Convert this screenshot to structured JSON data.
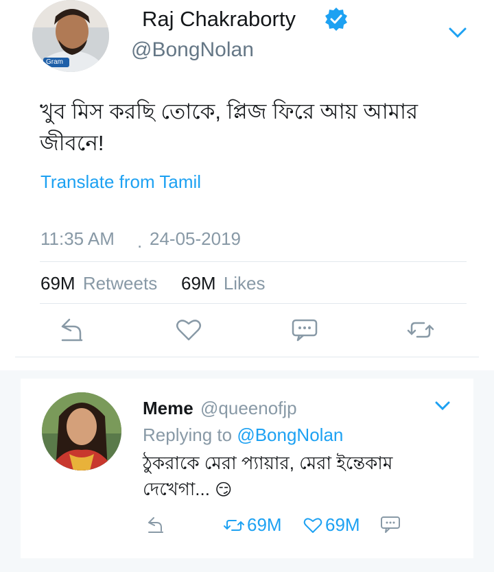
{
  "tweet": {
    "author_name": "Raj Chakraborty",
    "author_handle": "@BongNolan",
    "avatar_badge_text": "Gram",
    "text_line1": "খুব মিস করছি তোকে, প্লিজ ফিরে আয় আমার",
    "text_line2": "জীবনে!",
    "translate_label": "Translate from Tamil",
    "time": "11:35 AM",
    "date_separator": ".",
    "date": "24-05-2019",
    "retweets_count": "69M",
    "retweets_label": "Retweets",
    "likes_count": "69M",
    "likes_label": "Likes"
  },
  "reply": {
    "author_name": "Meme",
    "author_handle": "@queenofjp",
    "replying_prefix": "Replying to",
    "replying_handle": "@BongNolan",
    "text_line1": "ঠুকরাকে মেরা প্যায়ার, মেরা ইন্তেকাম",
    "text_line2": "দেখেগা...",
    "emoji": "😏",
    "retweets_count": "69M",
    "likes_count": "69M"
  },
  "colors": {
    "accent": "#1da1f2",
    "muted": "#8899a6",
    "divider": "#e1e8ed",
    "verified": "#1da1f2"
  },
  "icons": {
    "verified": "verified-badge-icon",
    "caret": "chevron-down-icon",
    "reply": "reply-icon",
    "like": "heart-icon",
    "message": "message-icon",
    "retweet": "retweet-icon"
  }
}
